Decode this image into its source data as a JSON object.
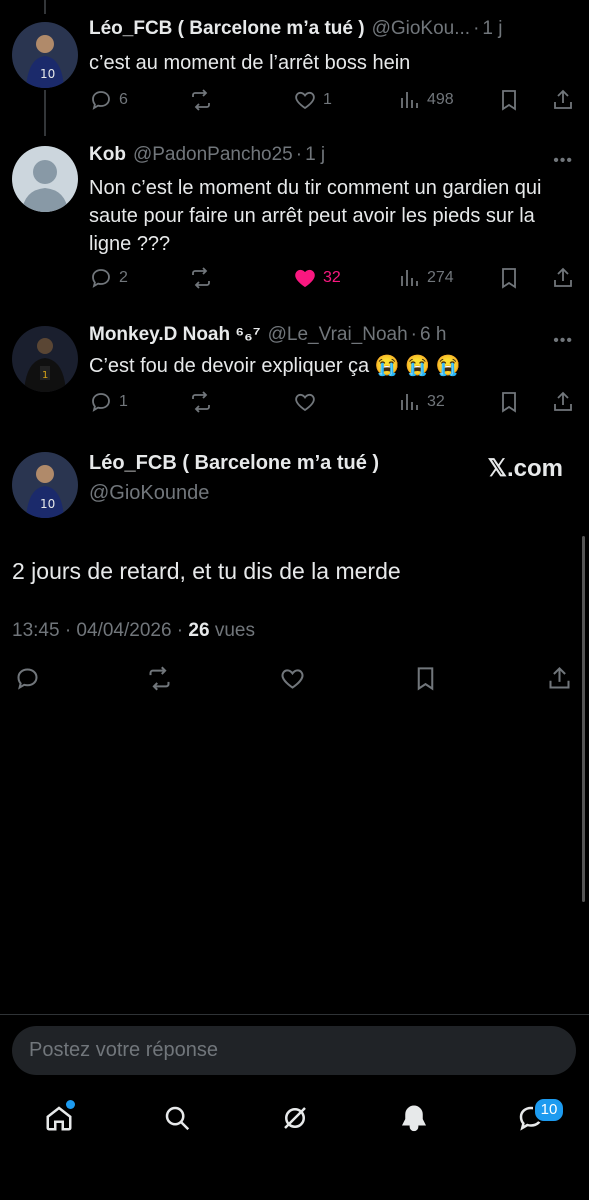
{
  "replies": [
    {
      "name": "Léo_FCB ( Barcelone m’a tué )",
      "handle": "@GioKou...",
      "time": "1 j",
      "text": "c’est au moment de l’arrêt boss hein",
      "replies": "6",
      "retweets": "",
      "likes": "1",
      "views": "498",
      "liked": false
    },
    {
      "name": "Kob",
      "handle": "@PadonPancho25",
      "time": "1 j",
      "text": "Non c’est le moment du tir comment un gardien qui saute pour faire un arrêt peut avoir les pieds sur la ligne ???",
      "replies": "2",
      "retweets": "",
      "likes": "32",
      "views": "274",
      "liked": true
    },
    {
      "name": "Monkey.D Noah ⁶₆⁷",
      "handle": "@Le_Vrai_Noah",
      "time": "6 h",
      "text": "C’est fou de devoir expliquer ça 😭 😭 😭",
      "replies": "1",
      "retweets": "",
      "likes": "",
      "views": "32",
      "liked": false
    }
  ],
  "main_tweet": {
    "name": "Léo_FCB ( Barcelone m’a tué )",
    "handle": "@GioKounde",
    "watermark": "𝕏.com",
    "text": "2 jours de retard, et tu dis de la merde",
    "timestamp": "13:45 · 04/04/2026 ·",
    "views_count": "26",
    "views_label": "vues"
  },
  "reply_box": {
    "placeholder": "Postez votre réponse"
  },
  "nav": {
    "items": [
      "home-icon",
      "search-icon",
      "grok-icon",
      "notifications-icon",
      "messages-icon"
    ],
    "messages_badge": "10"
  },
  "colors": {
    "background": "#000000",
    "accent": "#1d9bf0",
    "like": "#f91880",
    "muted": "#71767b"
  }
}
